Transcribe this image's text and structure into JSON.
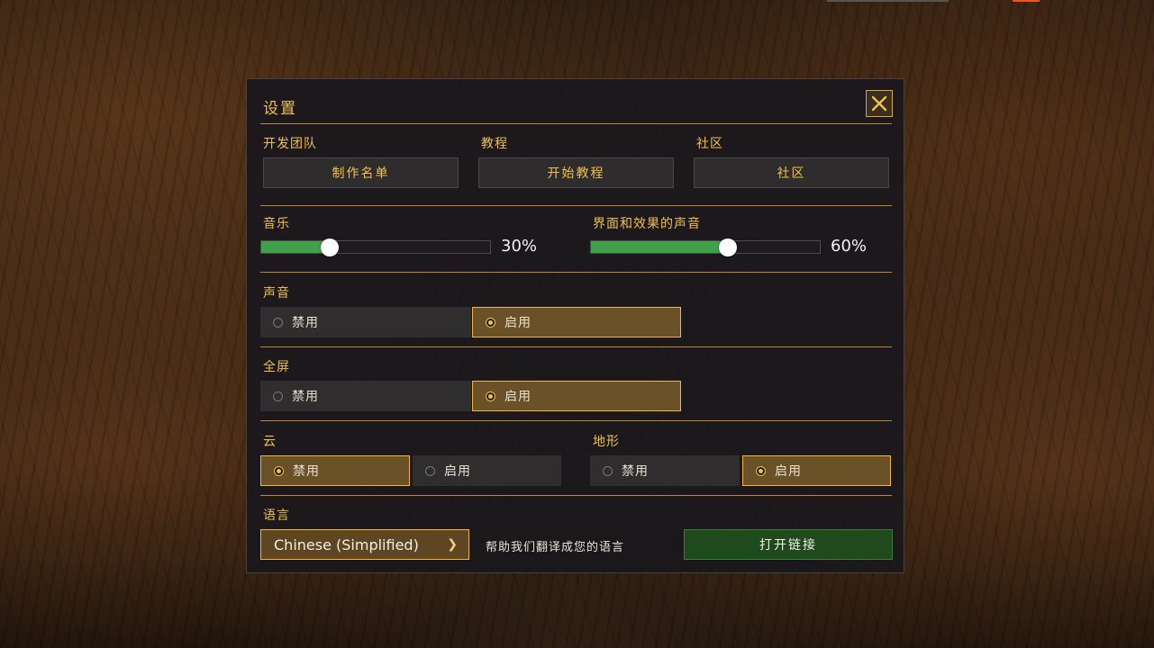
{
  "title": "设置",
  "top_links": [
    {
      "label": "开发团队",
      "button": "制作名单"
    },
    {
      "label": "教程",
      "button": "开始教程"
    },
    {
      "label": "社区",
      "button": "社区"
    }
  ],
  "music": {
    "label": "音乐",
    "value_text": "30%",
    "level": 0.3
  },
  "ui_sound": {
    "label": "界面和效果的声音",
    "value_text": "60%",
    "level": 0.6
  },
  "sound": {
    "label": "声音",
    "options": [
      "禁用",
      "启用"
    ],
    "selected": "启用"
  },
  "fullscreen": {
    "label": "全屏",
    "options": [
      "禁用",
      "启用"
    ],
    "selected": "启用"
  },
  "clouds": {
    "label": "云",
    "options": [
      "禁用",
      "启用"
    ],
    "selected": "禁用"
  },
  "terrain": {
    "label": "地形",
    "options": [
      "禁用",
      "启用"
    ],
    "selected": "启用"
  },
  "language": {
    "label": "语言",
    "selected": "Chinese (Simplified)",
    "help_text": "帮助我们翻译成您的语言",
    "open_link": "打开链接"
  },
  "colors": {
    "accent": "#f0c24a",
    "slider_fill": "#3fa24b",
    "selected_bg": "#6b5128",
    "link_bg": "#1f4a1e"
  },
  "icons": {
    "close": "close-icon",
    "chevron": "chevron-right-icon"
  }
}
